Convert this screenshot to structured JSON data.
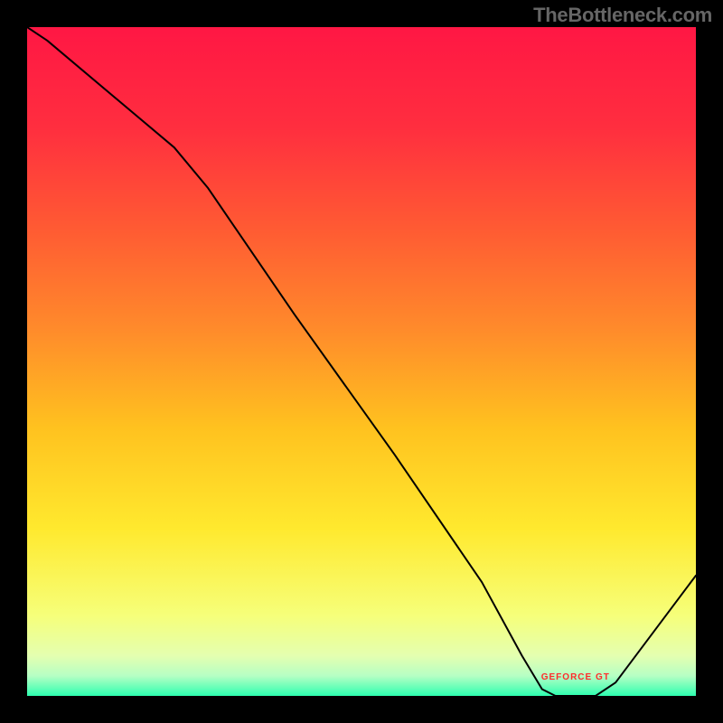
{
  "watermark": "TheBottleneck.com",
  "marker": {
    "label": "GEFORCE GT",
    "x_frac": 0.82,
    "y_frac": 0.975
  },
  "chart_data": {
    "type": "line",
    "title": "",
    "xlabel": "",
    "ylabel": "",
    "xlim": [
      0,
      100
    ],
    "ylim": [
      0,
      100
    ],
    "grid": false,
    "legend": false,
    "background_gradient": {
      "stops": [
        {
          "offset": 0.0,
          "color": "#ff1744"
        },
        {
          "offset": 0.15,
          "color": "#ff2e3f"
        },
        {
          "offset": 0.3,
          "color": "#ff5a33"
        },
        {
          "offset": 0.45,
          "color": "#ff8a2b"
        },
        {
          "offset": 0.6,
          "color": "#ffc21f"
        },
        {
          "offset": 0.75,
          "color": "#ffe92e"
        },
        {
          "offset": 0.88,
          "color": "#f6ff7a"
        },
        {
          "offset": 0.94,
          "color": "#e4ffb0"
        },
        {
          "offset": 0.97,
          "color": "#b6ffc4"
        },
        {
          "offset": 1.0,
          "color": "#2dffb0"
        }
      ]
    },
    "series": [
      {
        "name": "bottleneck-curve",
        "color": "#000000",
        "stroke_width": 2,
        "points": [
          {
            "x": 0,
            "y": 100
          },
          {
            "x": 3,
            "y": 98
          },
          {
            "x": 22,
            "y": 82
          },
          {
            "x": 27,
            "y": 76
          },
          {
            "x": 40,
            "y": 57
          },
          {
            "x": 55,
            "y": 36
          },
          {
            "x": 68,
            "y": 17
          },
          {
            "x": 74,
            "y": 6
          },
          {
            "x": 77,
            "y": 1
          },
          {
            "x": 79,
            "y": 0
          },
          {
            "x": 85,
            "y": 0
          },
          {
            "x": 88,
            "y": 2
          },
          {
            "x": 100,
            "y": 18
          }
        ]
      }
    ]
  }
}
